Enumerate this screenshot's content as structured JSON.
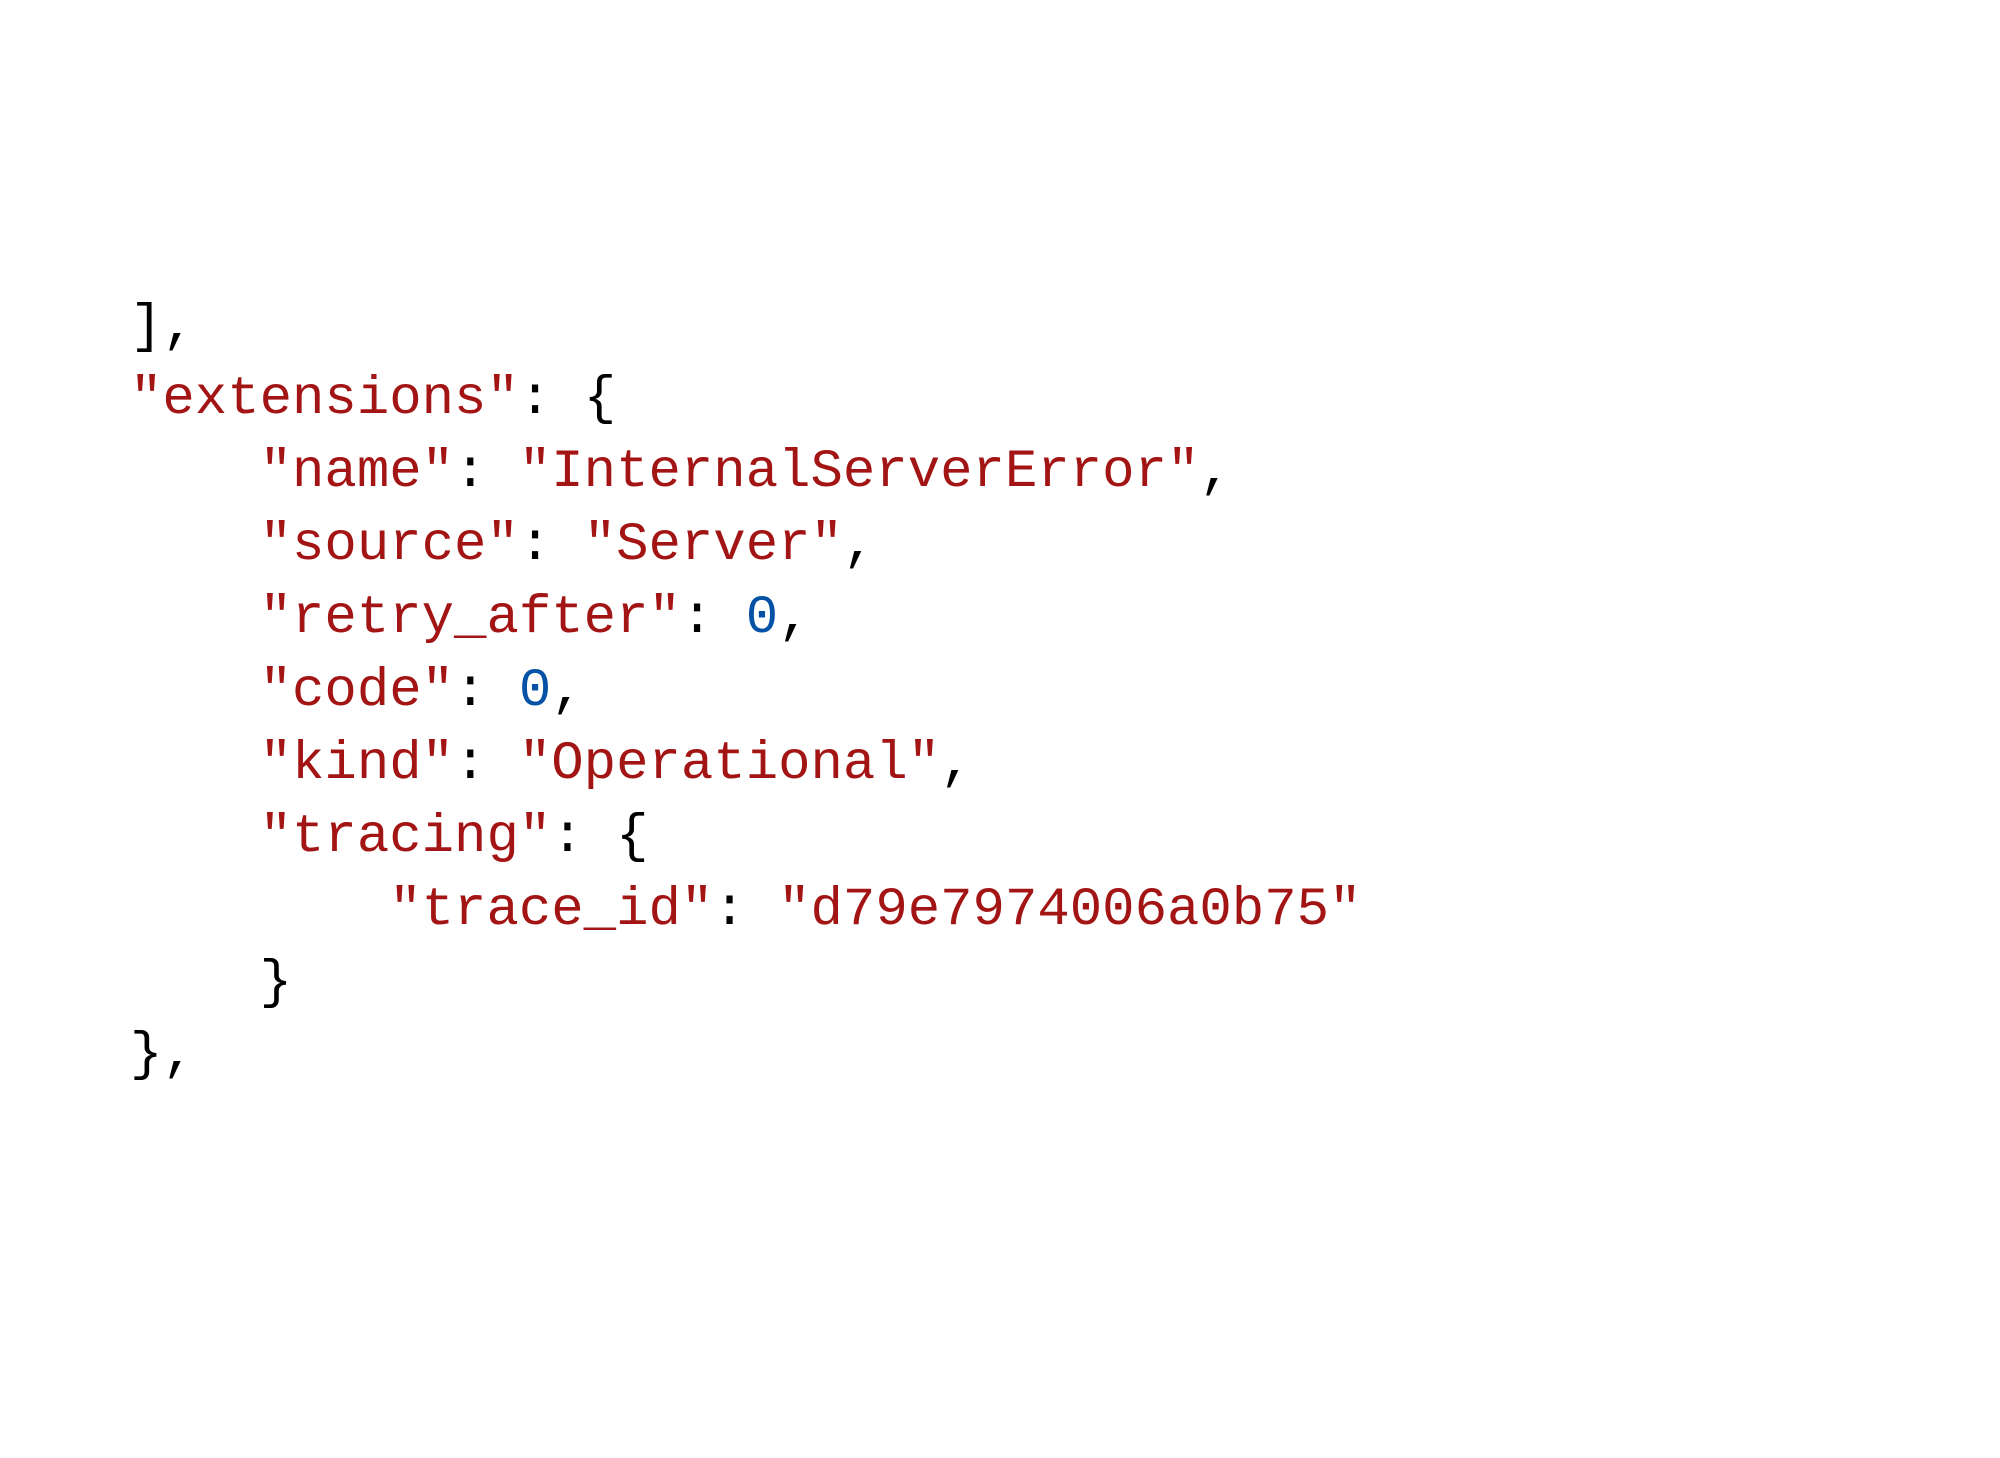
{
  "code": {
    "lines": [
      {
        "indent": 0,
        "tokens": [
          {
            "type": "bracket",
            "text": "]"
          },
          {
            "type": "comma",
            "text": ","
          }
        ]
      },
      {
        "indent": 0,
        "tokens": [
          {
            "type": "key",
            "text": "\"extensions\""
          },
          {
            "type": "colon",
            "text": ": "
          },
          {
            "type": "brace",
            "text": "{"
          }
        ]
      },
      {
        "indent": 1,
        "tokens": [
          {
            "type": "key",
            "text": "\"name\""
          },
          {
            "type": "colon",
            "text": ": "
          },
          {
            "type": "string",
            "text": "\"InternalServerError\""
          },
          {
            "type": "comma",
            "text": ","
          }
        ]
      },
      {
        "indent": 1,
        "tokens": [
          {
            "type": "key",
            "text": "\"source\""
          },
          {
            "type": "colon",
            "text": ": "
          },
          {
            "type": "string",
            "text": "\"Server\""
          },
          {
            "type": "comma",
            "text": ","
          }
        ]
      },
      {
        "indent": 1,
        "tokens": [
          {
            "type": "key",
            "text": "\"retry_after\""
          },
          {
            "type": "colon",
            "text": ": "
          },
          {
            "type": "number",
            "text": "0"
          },
          {
            "type": "comma",
            "text": ","
          }
        ]
      },
      {
        "indent": 1,
        "tokens": [
          {
            "type": "key",
            "text": "\"code\""
          },
          {
            "type": "colon",
            "text": ": "
          },
          {
            "type": "number",
            "text": "0"
          },
          {
            "type": "comma",
            "text": ","
          }
        ]
      },
      {
        "indent": 1,
        "tokens": [
          {
            "type": "key",
            "text": "\"kind\""
          },
          {
            "type": "colon",
            "text": ": "
          },
          {
            "type": "string",
            "text": "\"Operational\""
          },
          {
            "type": "comma",
            "text": ","
          }
        ]
      },
      {
        "indent": 1,
        "tokens": [
          {
            "type": "key",
            "text": "\"tracing\""
          },
          {
            "type": "colon",
            "text": ": "
          },
          {
            "type": "brace",
            "text": "{"
          }
        ]
      },
      {
        "indent": 2,
        "tokens": [
          {
            "type": "key",
            "text": "\"trace_id\""
          },
          {
            "type": "colon",
            "text": ": "
          },
          {
            "type": "string",
            "text": "\"d79e7974006a0b75\""
          }
        ]
      },
      {
        "indent": 1,
        "tokens": [
          {
            "type": "brace",
            "text": "}"
          }
        ]
      },
      {
        "indent": 0,
        "tokens": [
          {
            "type": "brace",
            "text": "}"
          },
          {
            "type": "comma",
            "text": ","
          }
        ]
      }
    ],
    "json_data": {
      "extensions": {
        "name": "InternalServerError",
        "source": "Server",
        "retry_after": 0,
        "code": 0,
        "kind": "Operational",
        "tracing": {
          "trace_id": "d79e7974006a0b75"
        }
      }
    }
  }
}
